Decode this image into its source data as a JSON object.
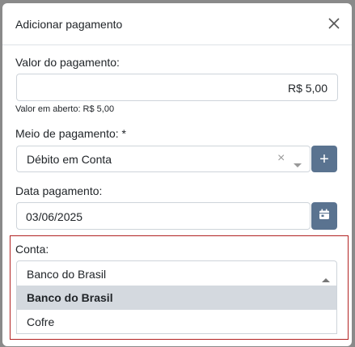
{
  "modal": {
    "title": "Adicionar pagamento",
    "close_icon": "close-icon"
  },
  "valor": {
    "label": "Valor do pagamento:",
    "value": "R$ 5,00",
    "help": "Valor em aberto: R$ 5,00"
  },
  "meio": {
    "label": "Meio de pagamento: *",
    "value": "Débito em Conta",
    "clear_symbol": "×",
    "add_symbol": "+"
  },
  "data_pagamento": {
    "label": "Data pagamento:",
    "value": "03/06/2025"
  },
  "conta": {
    "label": "Conta:",
    "value": "Banco do Brasil",
    "options": [
      "Banco do Brasil",
      "Cofre"
    ],
    "highlight_color": "#b22222"
  },
  "colors": {
    "primary_button": "#5a7390",
    "selected_option_bg": "#d4d9df"
  }
}
